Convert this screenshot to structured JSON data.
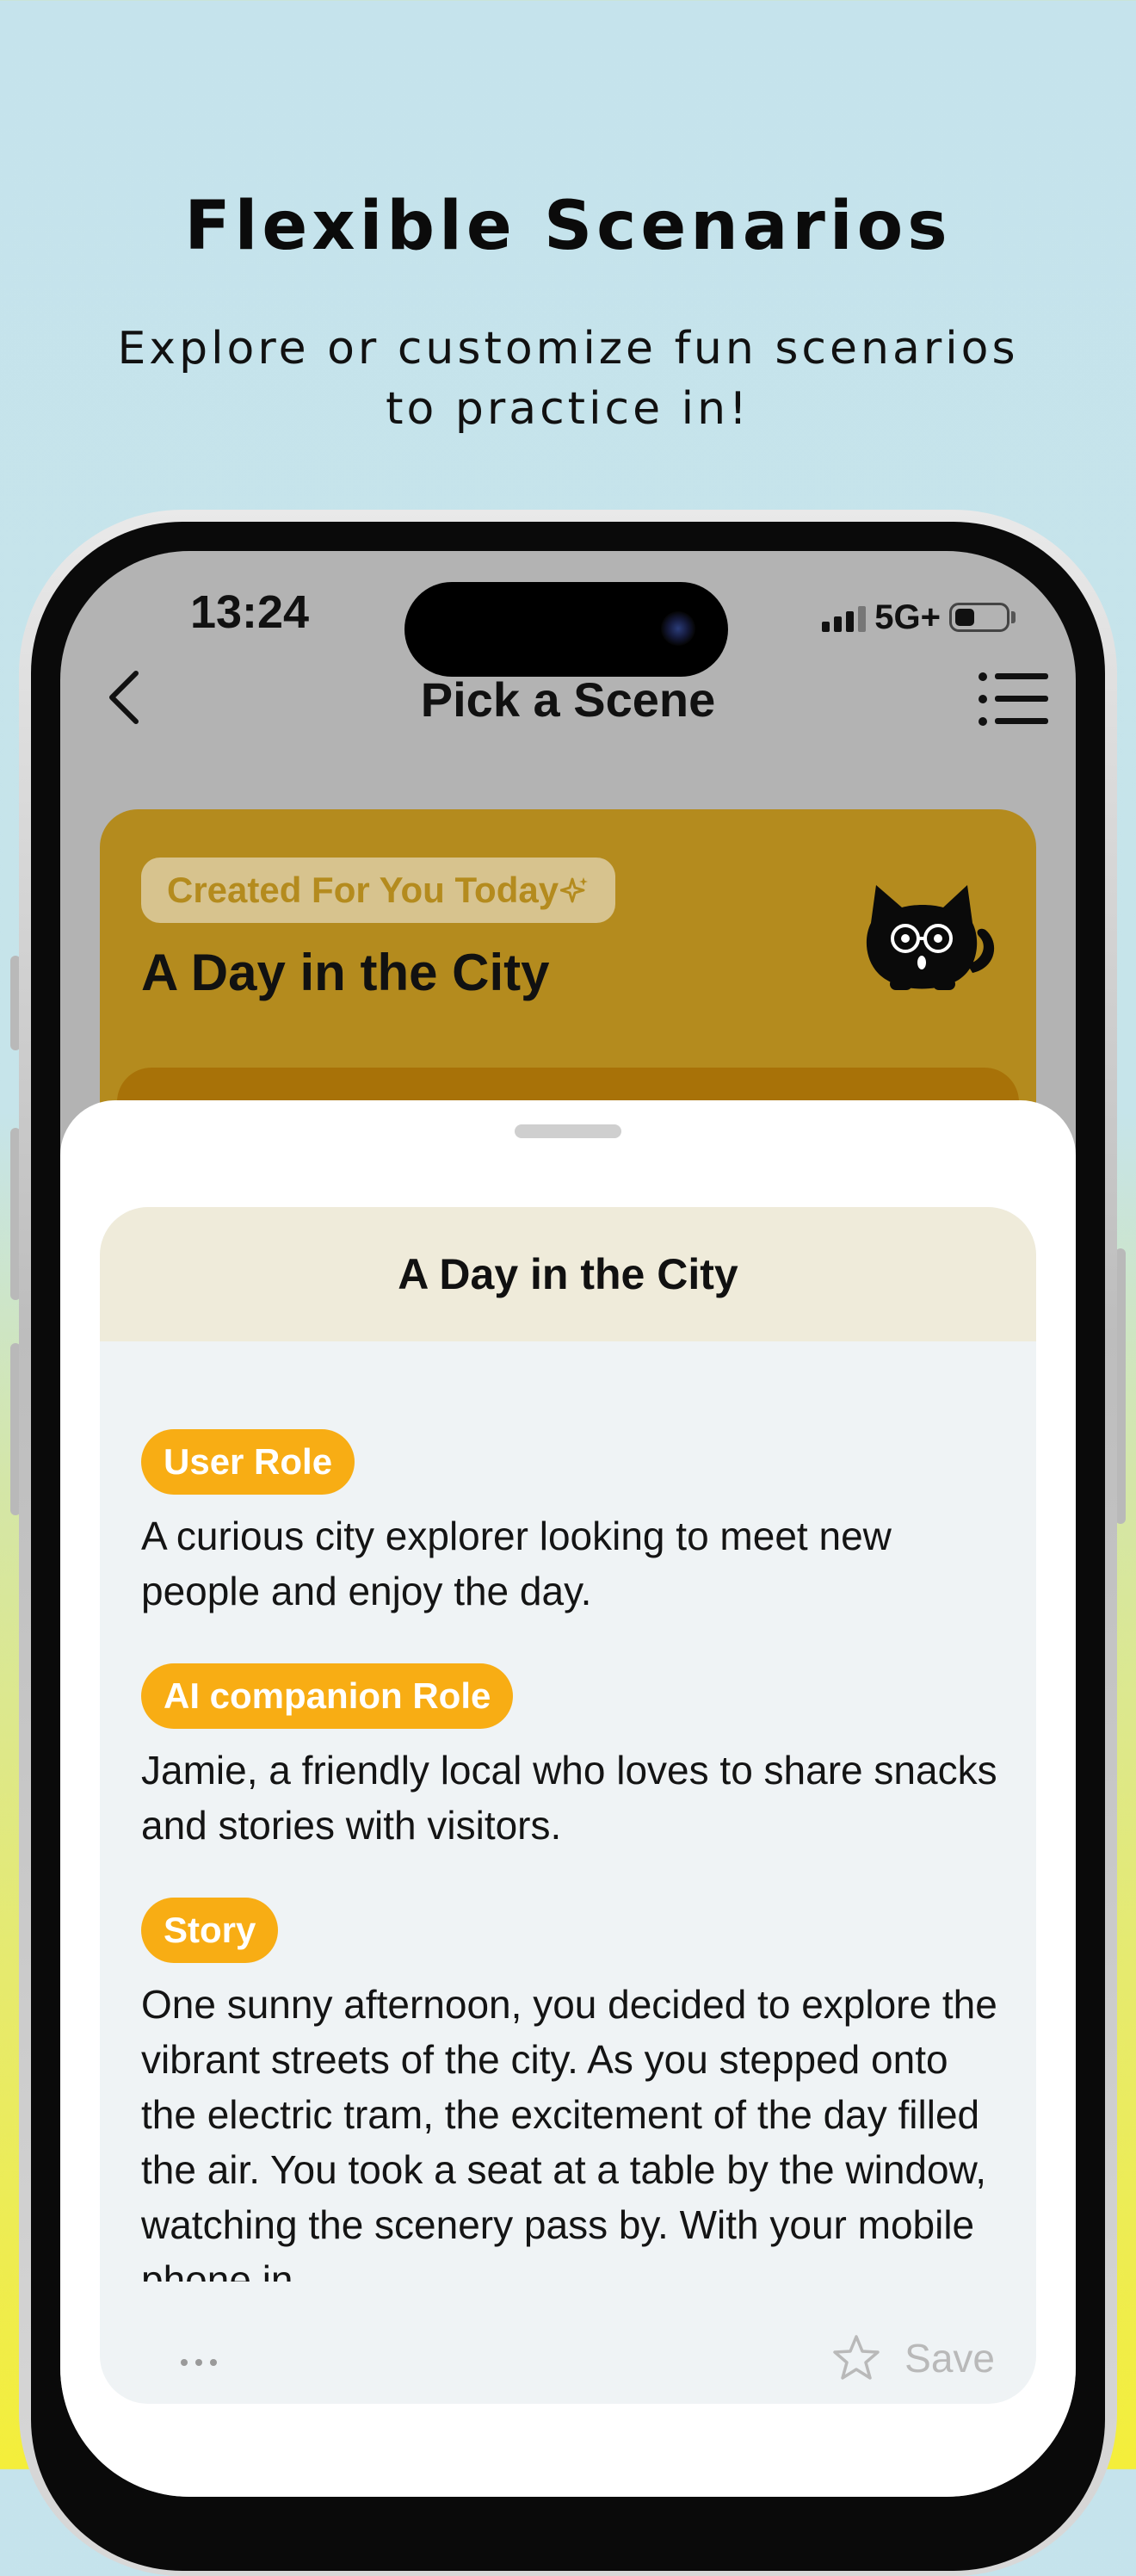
{
  "promo": {
    "headline": "Flexible Scenarios",
    "subheadline": "Explore or customize fun scenarios to practice in!"
  },
  "status_bar": {
    "time": "13:24",
    "network": "5G+"
  },
  "nav": {
    "title": "Pick a Scene",
    "back_icon": "chevron-left-icon",
    "menu_icon": "list-menu-icon"
  },
  "featured": {
    "badge": "Created For You Today",
    "badge_icon": "sparkle-icon",
    "title": "A Day in the City",
    "mascot": "black-cat-mascot"
  },
  "detail": {
    "title": "A Day in the City",
    "user_role_label": "User Role",
    "user_role_text": "A curious city explorer looking to meet new people and enjoy the day.",
    "ai_role_label": "AI companion Role",
    "ai_role_text": "Jamie, a friendly local who loves to share snacks and stories with visitors.",
    "story_label": "Story",
    "story_text": "One sunny afternoon, you decided to explore the vibrant streets of the city. As you stepped onto the electric tram, the excitement of the day filled the air. You took a seat at a table by the window, watching the scenery pass by. With your mobile phone in",
    "save_label": "Save",
    "more_icon": "more-dots-icon",
    "save_icon": "star-outline-icon"
  },
  "colors": {
    "accent_orange": "#f8ad14",
    "card_gold": "#b48b1e",
    "sheet_header": "#efebda"
  }
}
